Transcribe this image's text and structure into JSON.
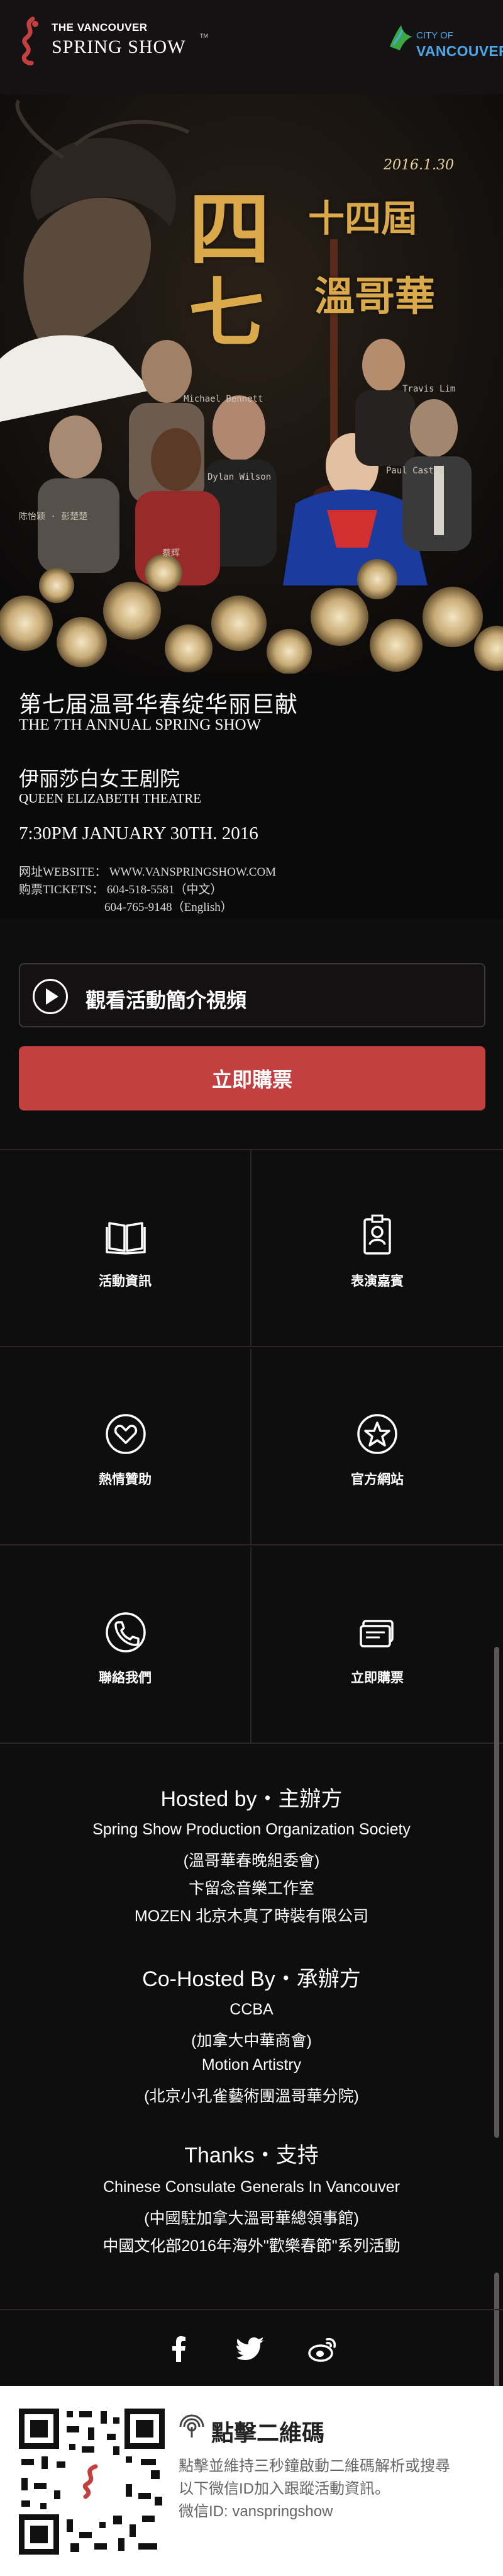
{
  "header": {
    "brand_small": "THE VANCOUVER",
    "brand_big": "SPRING SHOW",
    "brand_tm": "TM",
    "city_small": "CITY OF",
    "city_big": "VANCOUVER"
  },
  "poster": {
    "calli_big1": "四",
    "calli_big2": "七",
    "calli_small1": "十四屆",
    "calli_small2": "溫哥華",
    "calli_date": "2016.1.30",
    "performers": [
      "Michael Bennett",
      "Travis Lim",
      "Dylan Wilson",
      "Paul Castro",
      "陈怡颖 · 彭楚楚",
      "蔡辉"
    ],
    "cn_title": "第七届温哥华春绽华丽巨献",
    "en_title": "THE 7TH ANNUAL SPRING SHOW",
    "cn_venue": "伊丽莎白女王剧院",
    "en_venue": "QUEEN ELIZABETH THEATRE",
    "datetime": "7:30PM JANUARY 30TH. 2016",
    "website": "网址WEBSITE： WWW.VANSPRINGSHOW.COM",
    "tickets": "购票TICKETS： 604-518-5581（中文）",
    "tickets_en": "604-765-9148（English）"
  },
  "actions": {
    "video_label": "觀看活動簡介視頻",
    "buy_label": "立即購票"
  },
  "grid": [
    {
      "label": "活動資訊",
      "icon": "book-icon"
    },
    {
      "label": "表演嘉賓",
      "icon": "id-badge-icon"
    },
    {
      "label": "熱情贊助",
      "icon": "heart-icon"
    },
    {
      "label": "官方網站",
      "icon": "star-icon"
    },
    {
      "label": "聯絡我們",
      "icon": "phone-icon"
    },
    {
      "label": "立即購票",
      "icon": "ticket-icon"
    }
  ],
  "credits": {
    "hosted_head": "Hosted by・主辦方",
    "hosted_lines": [
      "Spring Show Production Organization Society",
      "(溫哥華春晚組委會)",
      "卞留念音樂工作室",
      "MOZEN 北京木真了時裝有限公司"
    ],
    "cohosted_head": "Co-Hosted By・承辦方",
    "cohosted_lines": [
      "CCBA",
      "(加拿大中華商會)",
      "Motion Artistry",
      "(北京小孔雀藝術團溫哥華分院)"
    ],
    "thanks_head": "Thanks・支持",
    "thanks_lines": [
      "Chinese Consulate Generals In Vancouver",
      "(中國駐加拿大溫哥華總領事館)",
      "中國文化部2016年海外\"歡樂春節\"系列活動"
    ]
  },
  "social": [
    "facebook-icon",
    "twitter-icon",
    "weibo-icon"
  ],
  "qr": {
    "title": "點擊二維碼",
    "desc1": "點擊並維持三秒鐘啟動二維碼解析或搜尋",
    "desc2": "以下微信ID加入跟蹤活動資訊。",
    "desc3": "微信ID: vanspringshow"
  },
  "colors": {
    "accent_red": "#c2403f",
    "city_blue": "#4da6e8",
    "gold": "#d9a94a",
    "background": "#0f0e0e"
  }
}
